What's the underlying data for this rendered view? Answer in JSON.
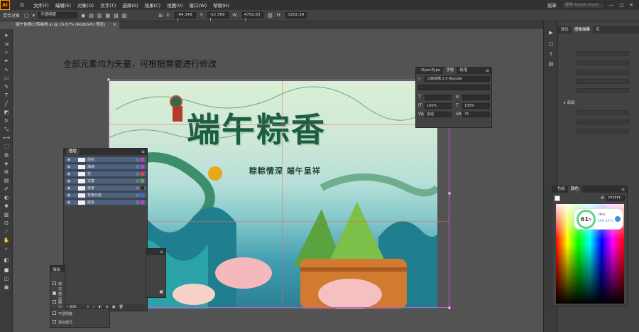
{
  "menubar": {
    "logo": "Ai",
    "items": [
      "文件(F)",
      "编辑(E)",
      "对象(O)",
      "文字(T)",
      "选择(S)",
      "效果(C)",
      "视图(V)",
      "窗口(W)",
      "帮助(H)"
    ],
    "workspace": "摇摹",
    "search_placeholder": "搜索 Adobe Stock"
  },
  "controlbar": {
    "selection_label": "混合对象",
    "opacity_label": "不透明度",
    "x_label": "X:",
    "x_value": "-94.349 ]",
    "y_label": "Y:",
    "y_value": "-52.389 ]",
    "w_label": "W:",
    "w_value": "4792.63 ]",
    "h_label": "H:",
    "h_value": "3202.39"
  },
  "document": {
    "tab_title": "端午包裹01转曲线.ai @ 16.67% (RGB/GPU 预览)"
  },
  "canvas": {
    "caption": "全部元素均为矢量，可根据需要进行修改"
  },
  "artwork": {
    "title": "端午粽香",
    "subtitle": "粽粽情深  端午呈祥"
  },
  "layers_panel": {
    "tab": "图层",
    "footer_label": "1 图层",
    "rows": [
      {
        "name": "前花",
        "color": "#c43cc8"
      },
      {
        "name": "海浪",
        "color": "#c43cc8"
      },
      {
        "name": "龙",
        "color": "#e04040"
      },
      {
        "name": "文案",
        "color": "#4caf50"
      },
      {
        "name": "浪身",
        "color": "#303030"
      },
      {
        "name": "背景元素",
        "color": "#3a6ad8"
      },
      {
        "name": "底色",
        "color": "#c43cc8"
      }
    ]
  },
  "appearance_panel": {
    "tab": "描绘",
    "items": [
      {
        "label": "填充",
        "checked": false
      },
      {
        "label": "描边",
        "checked": true
      },
      {
        "label": "描边",
        "checked": false
      },
      {
        "label": "不透明度",
        "checked": false
      },
      {
        "label": "混合模式",
        "checked": false
      }
    ]
  },
  "character_panel": {
    "tabs": [
      "OpenType",
      "字符",
      "段落"
    ],
    "active_tab": "字符",
    "font_family": "江西拙楷 2.0 Regular",
    "font_style": "-",
    "scale_h": "100%",
    "scale_v": "100%",
    "kerning": "自动",
    "tracking": "75"
  },
  "right_dock": {
    "tabs": [
      "属性",
      "图像描摹",
      "库"
    ],
    "active_tab": "图像描摹",
    "advanced_label": "高级"
  },
  "color_panel": {
    "tabs": [
      "色板",
      "颜色"
    ],
    "active_tab": "颜色",
    "hex": "FFFFFF"
  },
  "cpu_widget": {
    "percent": "61",
    "unit": "%",
    "speed": "0K/s",
    "temp": "CPU 35°C"
  }
}
